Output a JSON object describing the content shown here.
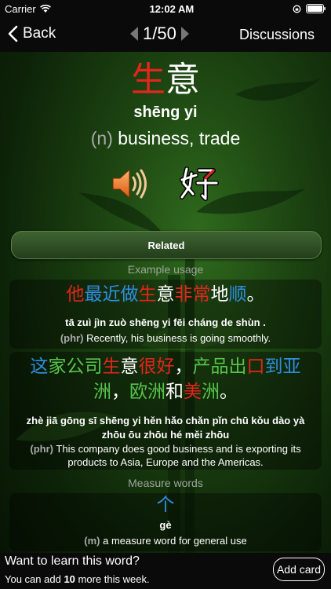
{
  "colors": {
    "red": "#e3261c",
    "blue": "#2f8ee0",
    "green": "#57c44a",
    "white": "#ffffff"
  },
  "status_bar": {
    "carrier": "Carrier",
    "time": "12:02 AM"
  },
  "nav": {
    "back_label": "Back",
    "pager": "1/50",
    "discussions_label": "Discussions"
  },
  "word": {
    "chars": [
      {
        "t": "生",
        "c": "red"
      },
      {
        "t": "意",
        "c": "white"
      }
    ],
    "pinyin": "shēng yi",
    "pos": "(n)",
    "meaning": "business, trade"
  },
  "icons": {
    "speaker": "speaker-icon",
    "stroke": "stroke-order-icon"
  },
  "related_label": "Related",
  "example_usage": {
    "heading": "Example usage",
    "examples": [
      {
        "hanzi": [
          {
            "t": "他",
            "c": "red"
          },
          {
            "t": "最近",
            "c": "blue"
          },
          {
            "t": "做",
            "c": "blue"
          },
          {
            "t": "生",
            "c": "red"
          },
          {
            "t": "意",
            "c": "white"
          },
          {
            "t": "非",
            "c": "red"
          },
          {
            "t": "常",
            "c": "red"
          },
          {
            "t": "地",
            "c": "white"
          },
          {
            "t": "顺",
            "c": "blue"
          },
          {
            "t": "。",
            "c": "white"
          }
        ],
        "pinyin": "tā zuì jìn zuò shēng yi fēi cháng de shùn .",
        "pos": "(phr)",
        "translation": "Recently, his business is going smoothly."
      },
      {
        "hanzi_lines": [
          [
            {
              "t": "这",
              "c": "blue"
            },
            {
              "t": "家",
              "c": "green"
            },
            {
              "t": "公",
              "c": "green"
            },
            {
              "t": "司",
              "c": "green"
            },
            {
              "t": "生",
              "c": "red"
            },
            {
              "t": "意",
              "c": "white"
            },
            {
              "t": "很",
              "c": "red"
            },
            {
              "t": "好",
              "c": "red"
            },
            {
              "t": "，",
              "c": "white"
            },
            {
              "t": "产",
              "c": "green"
            },
            {
              "t": "品",
              "c": "green"
            },
            {
              "t": "出",
              "c": "green"
            },
            {
              "t": "口",
              "c": "red"
            },
            {
              "t": "到",
              "c": "blue"
            },
            {
              "t": "亚",
              "c": "blue"
            }
          ],
          [
            {
              "t": "洲",
              "c": "green"
            },
            {
              "t": "，",
              "c": "white"
            },
            {
              "t": "欧",
              "c": "green"
            },
            {
              "t": "洲",
              "c": "green"
            },
            {
              "t": "和",
              "c": "white"
            },
            {
              "t": "美",
              "c": "red"
            },
            {
              "t": "洲",
              "c": "green"
            },
            {
              "t": "。",
              "c": "white"
            }
          ]
        ],
        "pinyin_lines": [
          "zhè jiā gōng sī shēng yi hěn hǎo chǎn pǐn chū kǒu dào yà",
          "zhōu ōu zhōu hé měi zhōu"
        ],
        "pos": "(phr)",
        "translation_lines": [
          "This company does good business and is exporting its",
          "products to Asia, Europe and the Americas."
        ]
      }
    ]
  },
  "measure_words": {
    "heading": "Measure words",
    "char": "个",
    "pinyin": "gè",
    "pos": "(m)",
    "meaning": "a measure word for general use"
  },
  "footer": {
    "question": "Want to learn this word?",
    "note_prefix": "You can add ",
    "note_count": "10",
    "note_suffix": " more this week.",
    "add_label": "Add card"
  }
}
